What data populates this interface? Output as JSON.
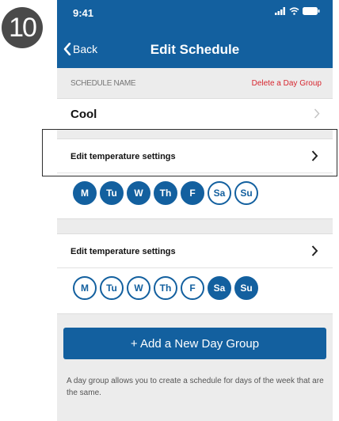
{
  "step": {
    "number": "10"
  },
  "status_bar": {
    "time": "9:41"
  },
  "nav": {
    "back_label": "Back",
    "title": "Edit Schedule"
  },
  "schedule": {
    "section_label": "SCHEDULE NAME",
    "delete_label": "Delete a Day Group",
    "name": "Cool"
  },
  "day_groups": [
    {
      "label": "Edit temperature settings",
      "days": [
        {
          "label": "M",
          "selected": true
        },
        {
          "label": "Tu",
          "selected": true
        },
        {
          "label": "W",
          "selected": true
        },
        {
          "label": "Th",
          "selected": true
        },
        {
          "label": "F",
          "selected": true
        },
        {
          "label": "Sa",
          "selected": false
        },
        {
          "label": "Su",
          "selected": false
        }
      ]
    },
    {
      "label": "Edit temperature settings",
      "days": [
        {
          "label": "M",
          "selected": false
        },
        {
          "label": "Tu",
          "selected": false
        },
        {
          "label": "W",
          "selected": false
        },
        {
          "label": "Th",
          "selected": false
        },
        {
          "label": "F",
          "selected": false
        },
        {
          "label": "Sa",
          "selected": true
        },
        {
          "label": "Su",
          "selected": true
        }
      ]
    }
  ],
  "add_button": {
    "label": "+ Add a New Day Group"
  },
  "help": {
    "text": "A day group allows you to create a schedule for days of the week that are the same."
  },
  "colors": {
    "primary": "#13609f",
    "danger": "#d7262f",
    "background": "#ececec"
  }
}
